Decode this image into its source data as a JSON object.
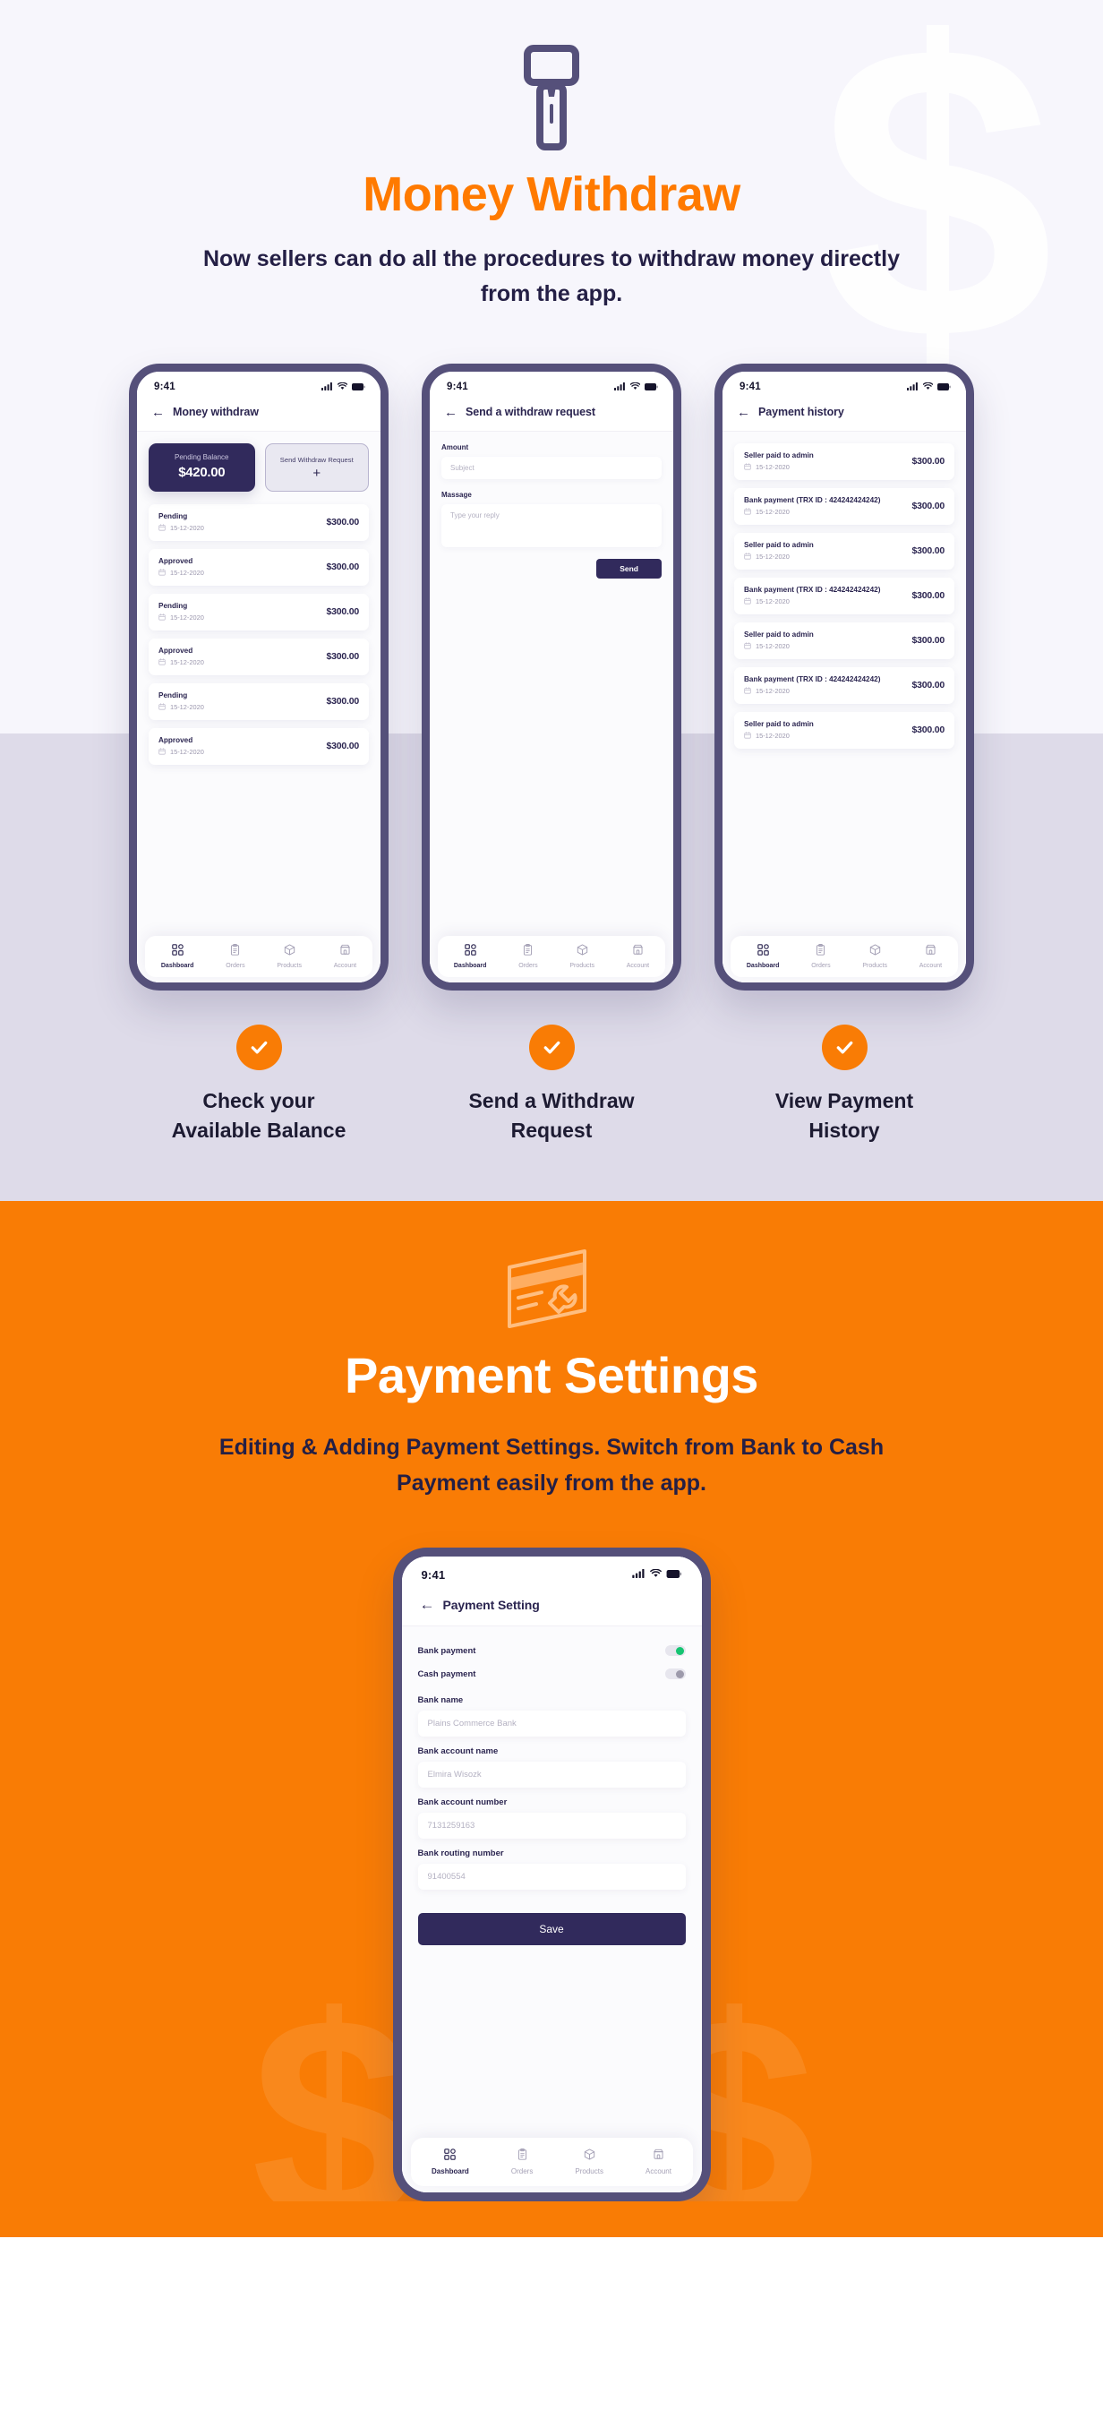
{
  "section_withdraw": {
    "icon": "flashlight-icon",
    "background_watermark": "$",
    "title": "Money Withdraw",
    "subtitle": "Now sellers can do all the procedures to withdraw money directly from the app.",
    "accent_color": "#ff7a00",
    "bg_color": "#f7f6fc",
    "band_color": "#dedbe9",
    "phones": [
      {
        "status_time": "9:41",
        "app_title": "Money withdraw",
        "back_icon": "arrow-left-icon",
        "balance_card": {
          "label": "Pending Balance",
          "value": "$420.00"
        },
        "request_card": {
          "label": "Send Withdraw Request",
          "plus": "+"
        },
        "transactions": [
          {
            "status": "Pending",
            "date": "15-12-2020",
            "amount": "$300.00"
          },
          {
            "status": "Approved",
            "date": "15-12-2020",
            "amount": "$300.00"
          },
          {
            "status": "Pending",
            "date": "15-12-2020",
            "amount": "$300.00"
          },
          {
            "status": "Approved",
            "date": "15-12-2020",
            "amount": "$300.00"
          },
          {
            "status": "Pending",
            "date": "15-12-2020",
            "amount": "$300.00"
          },
          {
            "status": "Approved",
            "date": "15-12-2020",
            "amount": "$300.00"
          }
        ]
      },
      {
        "status_time": "9:41",
        "app_title": "Send a withdraw request",
        "back_icon": "arrow-left-icon",
        "form": {
          "amount_label": "Amount",
          "amount_placeholder": "Subject",
          "message_label": "Massage",
          "message_placeholder": "Type your reply",
          "send_label": "Send"
        }
      },
      {
        "status_time": "9:41",
        "app_title": "Payment history",
        "back_icon": "arrow-left-icon",
        "history": [
          {
            "title": "Seller paid to admin",
            "date": "15-12-2020",
            "amount": "$300.00"
          },
          {
            "title": "Bank payment (TRX ID : 424242424242)",
            "date": "15-12-2020",
            "amount": "$300.00"
          },
          {
            "title": "Seller paid to admin",
            "date": "15-12-2020",
            "amount": "$300.00"
          },
          {
            "title": "Bank payment (TRX ID : 424242424242)",
            "date": "15-12-2020",
            "amount": "$300.00"
          },
          {
            "title": "Seller paid to admin",
            "date": "15-12-2020",
            "amount": "$300.00"
          },
          {
            "title": "Bank payment (TRX ID : 424242424242)",
            "date": "15-12-2020",
            "amount": "$300.00"
          },
          {
            "title": "Seller paid to admin",
            "date": "15-12-2020",
            "amount": "$300.00"
          }
        ]
      }
    ],
    "captions": [
      {
        "line1": "Check your",
        "line2": "Available Balance"
      },
      {
        "line1": "Send a Withdraw",
        "line2": "Request"
      },
      {
        "line1": "View Payment",
        "line2": "History"
      }
    ],
    "check_icon": "check-circle-icon",
    "check_color": "#f97c05"
  },
  "section_settings": {
    "icon": "card-wrench-icon",
    "background_watermark": "$$$",
    "title": "Payment Settings",
    "subtitle": "Editing & Adding Payment Settings. Switch from Bank to Cash Payment easily from the app.",
    "bg_color": "#f97c05",
    "phone": {
      "status_time": "9:41",
      "app_title": "Payment Setting",
      "back_icon": "arrow-left-icon",
      "toggles": [
        {
          "label": "Bank payment",
          "state": "on",
          "color": "#16c472"
        },
        {
          "label": "Cash payment",
          "state": "off",
          "color": "#9d9aab"
        }
      ],
      "fields": [
        {
          "label": "Bank name",
          "placeholder": "Plains Commerce Bank"
        },
        {
          "label": "Bank account name",
          "placeholder": "Elmira Wisozk"
        },
        {
          "label": "Bank account number",
          "placeholder": "7131259163"
        },
        {
          "label": "Bank routing number",
          "placeholder": "91400554"
        }
      ],
      "save_label": "Save"
    }
  },
  "bottom_nav": {
    "items": [
      {
        "label": "Dashboard",
        "icon": "grid-icon",
        "active": true
      },
      {
        "label": "Orders",
        "icon": "clipboard-icon",
        "active": false
      },
      {
        "label": "Products",
        "icon": "box-icon",
        "active": false
      },
      {
        "label": "Account",
        "icon": "store-icon",
        "active": false
      }
    ]
  }
}
